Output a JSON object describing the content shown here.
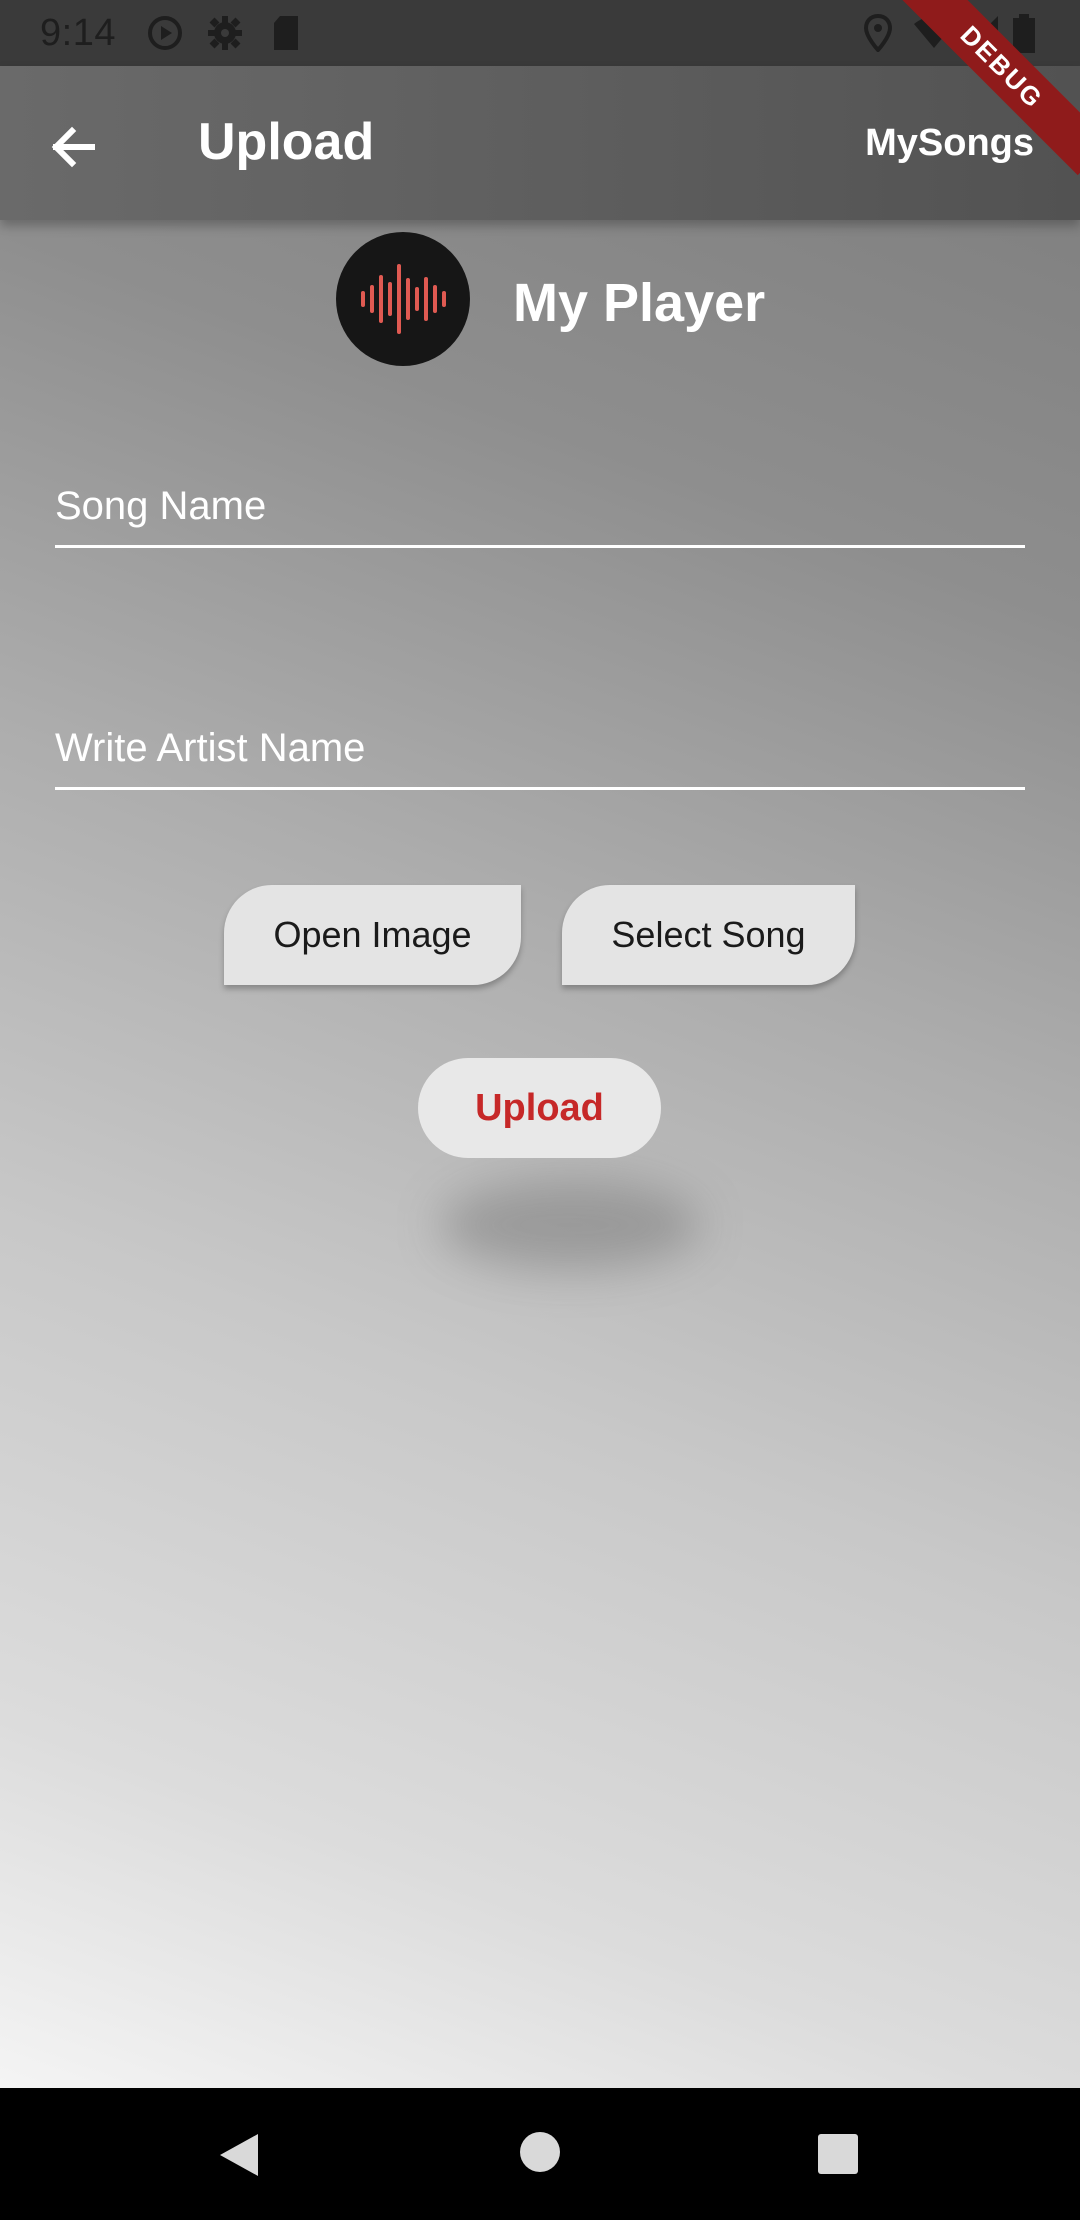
{
  "status_bar": {
    "time": "9:14",
    "icons": [
      "play-circle-icon",
      "gear-icon",
      "sd-card-icon",
      "location-icon",
      "wifi-icon",
      "signal-icon",
      "battery-icon"
    ]
  },
  "app_bar": {
    "title": "Upload",
    "action_label": "MySongs",
    "debug_label": "DEBUG"
  },
  "brand": {
    "name": "My Player",
    "logo_color": "#e05a52"
  },
  "form": {
    "song_name_placeholder": "Song Name",
    "artist_name_placeholder": "Write Artist Name",
    "open_image_label": "Open Image",
    "select_song_label": "Select Song",
    "upload_label": "Upload"
  },
  "colors": {
    "accent_red": "#c62828",
    "debug_banner": "#8f1b1b"
  },
  "nav_bar": {
    "icons": [
      "back-triangle-icon",
      "home-circle-icon",
      "recents-square-icon"
    ]
  }
}
